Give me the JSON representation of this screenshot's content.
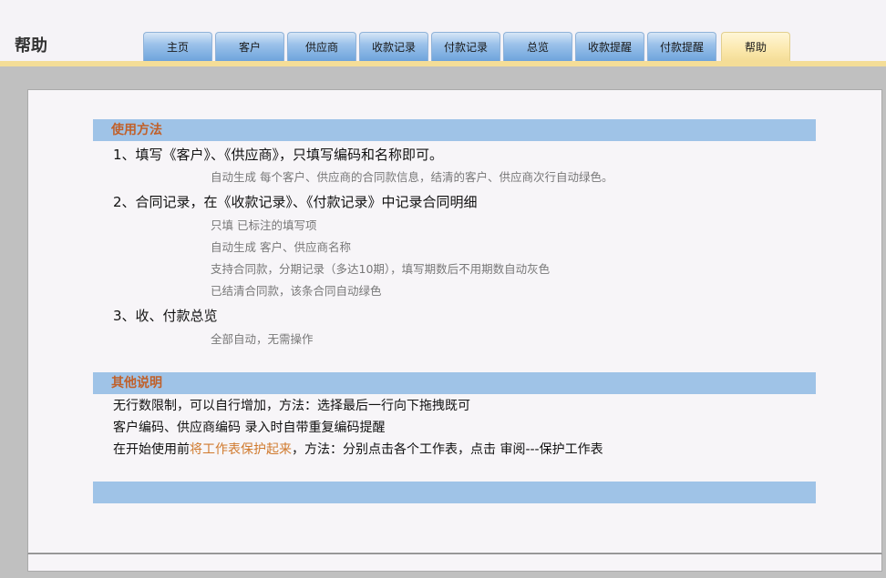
{
  "header": {
    "title": "帮助",
    "tabs": [
      {
        "label": "主页",
        "active": false
      },
      {
        "label": "客户",
        "active": false
      },
      {
        "label": "供应商",
        "active": false
      },
      {
        "label": "收款记录",
        "active": false
      },
      {
        "label": "付款记录",
        "active": false
      },
      {
        "label": "总览",
        "active": false
      },
      {
        "label": "收款提醒",
        "active": false
      },
      {
        "label": "付款提醒",
        "active": false
      },
      {
        "label": "帮助",
        "active": true
      }
    ]
  },
  "usage": {
    "title": "使用方法",
    "step1": {
      "text": "1、填写《客户》、《供应商》，只填写编码和名称即可。",
      "notes": [
        "自动生成 每个客户、供应商的合同款信息，结清的客户、供应商次行自动绿色。"
      ]
    },
    "step2": {
      "text": "2、合同记录，在《收款记录》、《付款记录》中记录合同明细",
      "notes": [
        "只填 已标注的填写项",
        "自动生成 客户、供应商名称",
        "支持合同款，分期记录（多达10期），填写期数后不用期数自动灰色",
        "已结清合同款，该条合同自动绿色"
      ]
    },
    "step3": {
      "text": "3、收、付款总览",
      "notes": [
        "全部自动，无需操作"
      ]
    }
  },
  "other": {
    "title": "其他说明",
    "line1": "无行数限制，可以自行增加，方法：选择最后一行向下拖拽既可",
    "line2": "客户编码、供应商编码 录入时自带重复编码提醒",
    "line3_prefix": "在开始使用前",
    "line3_highlight": "将工作表保护起来",
    "line3_suffix": "，方法：分别点击各个工作表，点击  审阅---保护工作表"
  },
  "colors": {
    "tab_blue": "#6ea4dc",
    "tab_active": "#f4dd97",
    "section_bar": "#9fc3e7",
    "section_title": "#c0602a",
    "highlight": "#d07a2e"
  }
}
